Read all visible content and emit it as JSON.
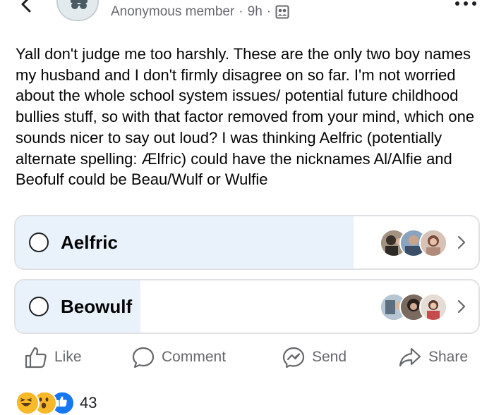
{
  "header": {
    "author": "Anonymous member",
    "time": "9h",
    "separator": "·",
    "audience_icon": "group-icon"
  },
  "post": {
    "text": "Yall don't judge me too harshly. These are the only two boy names my husband and I don't firmly disagree on so far. I'm not worried about the whole school system issues/ potential future childhood bullies  stuff, so with that factor removed from your mind, which one sounds nicer to say out loud? I was thinking Aelfric (potentially alternate spelling: Ælfric) could have the nicknames Al/Alfie and Beofulf could be Beau/Wulf or Wulfie"
  },
  "poll": {
    "options": [
      {
        "label": "Aelfric",
        "fill_fraction": 0.73
      },
      {
        "label": "Beowulf",
        "fill_fraction": 0.27
      }
    ]
  },
  "actions": {
    "like": "Like",
    "comment": "Comment",
    "send": "Send",
    "share": "Share"
  },
  "reactions": {
    "icons": [
      "haha-icon",
      "wow-icon",
      "like-icon"
    ],
    "count": "43"
  },
  "colors": {
    "fill": "#e9f2fb",
    "border": "#dfe1e5",
    "muted": "#65676b",
    "like_blue": "#1877f2",
    "reaction_yellow": "#f7b928"
  }
}
